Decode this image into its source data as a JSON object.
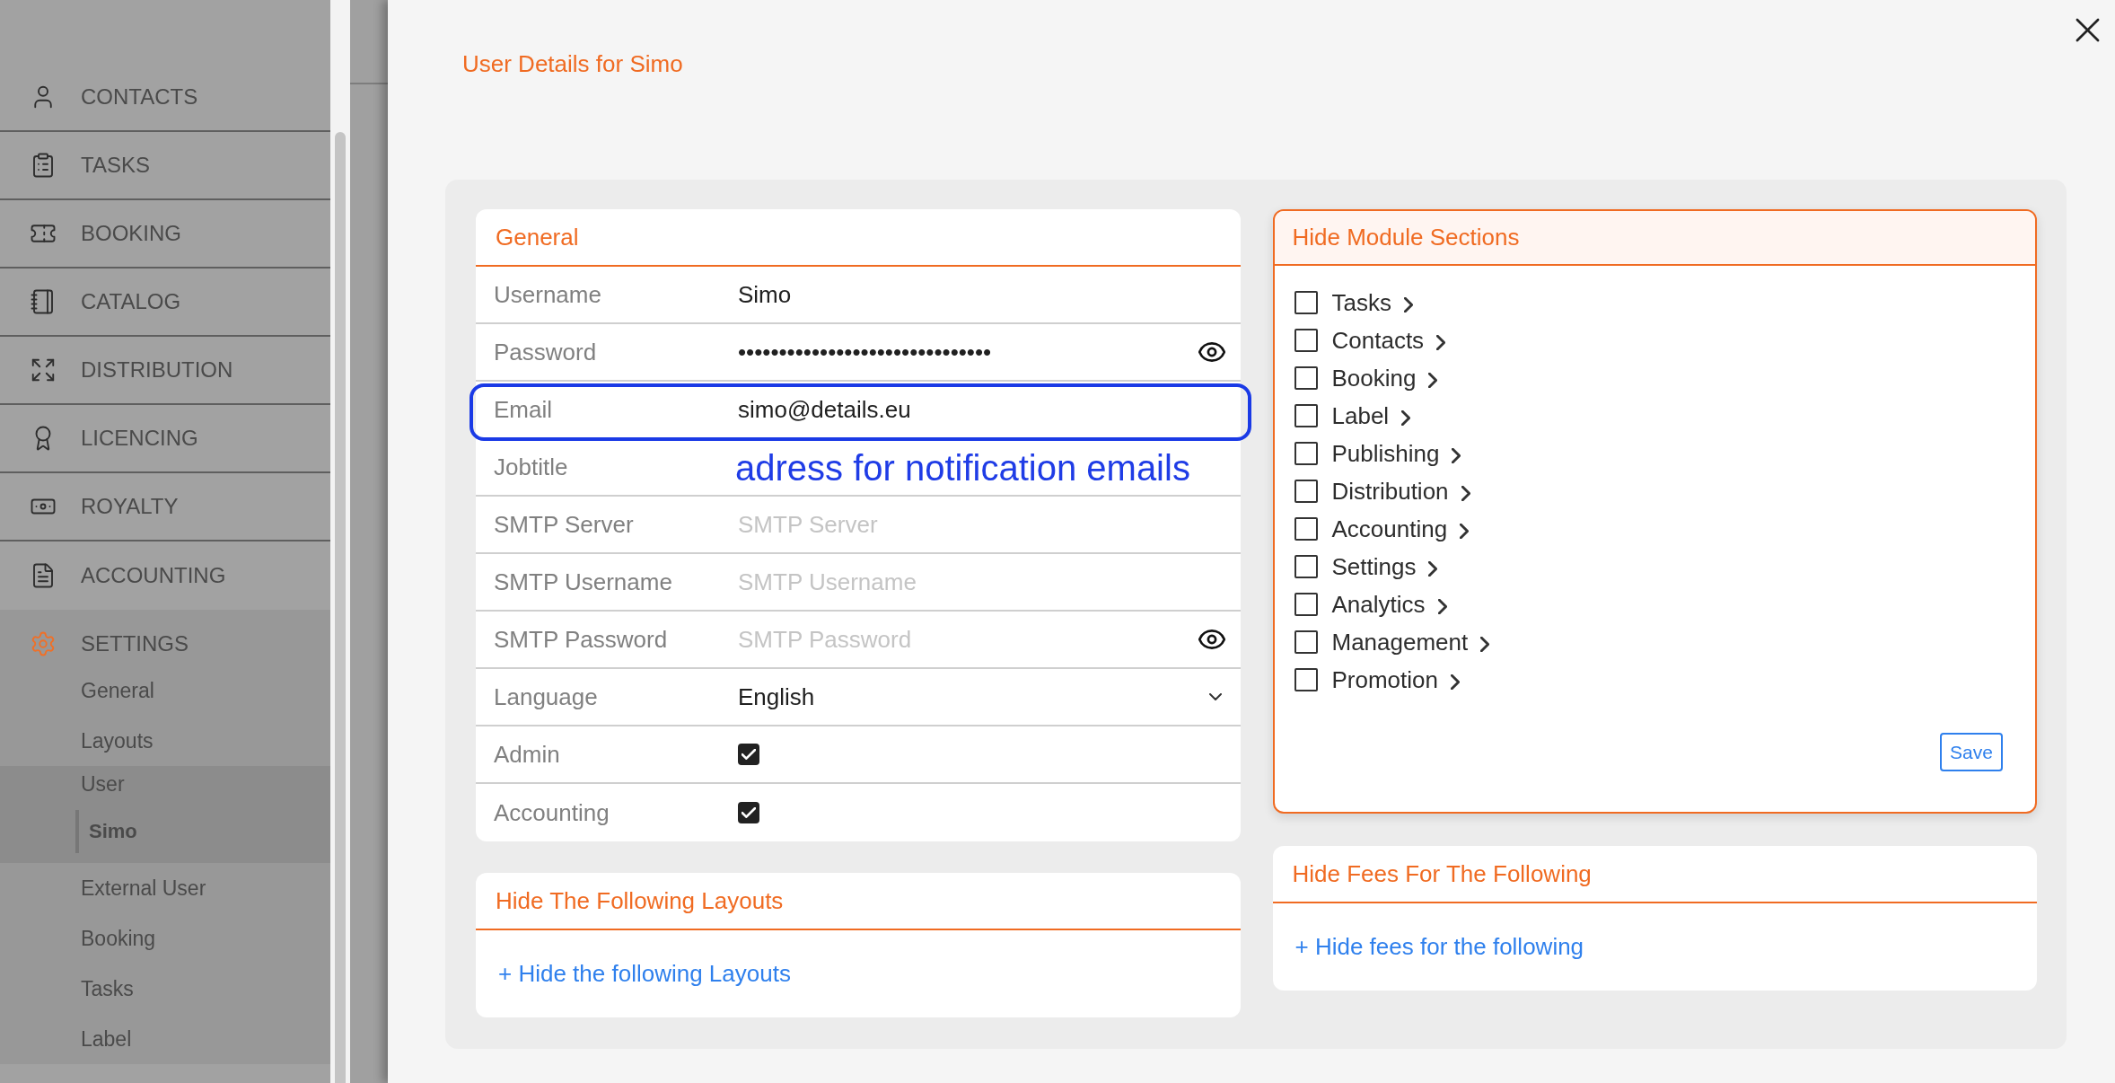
{
  "sidebar": {
    "items": [
      {
        "label": "CONTACTS",
        "expanded": false
      },
      {
        "label": "TASKS",
        "expanded": false
      },
      {
        "label": "BOOKING",
        "expanded": false
      },
      {
        "label": "CATALOG",
        "expanded": false
      },
      {
        "label": "DISTRIBUTION",
        "expanded": false
      },
      {
        "label": "LICENCING",
        "expanded": false
      },
      {
        "label": "ROYALTY",
        "expanded": false
      },
      {
        "label": "ACCOUNTING",
        "expanded": false
      },
      {
        "label": "SETTINGS",
        "expanded": true,
        "children": [
          {
            "label": "General",
            "selected": false,
            "expanded": false
          },
          {
            "label": "Layouts",
            "selected": false,
            "expanded": false
          },
          {
            "label": "User",
            "selected": false,
            "expanded": true,
            "children": [
              {
                "label": "Simo",
                "selected": true
              }
            ]
          },
          {
            "label": "External User",
            "selected": false,
            "expanded": false
          },
          {
            "label": "Booking",
            "selected": false,
            "expanded": false
          },
          {
            "label": "Tasks",
            "selected": false,
            "expanded": false
          },
          {
            "label": "Label",
            "selected": false,
            "expanded": false
          }
        ]
      }
    ]
  },
  "drawer": {
    "title": "User Details for Simo"
  },
  "general": {
    "title": "General",
    "rows": [
      {
        "label": "Username",
        "kind": "text",
        "value": "Simo",
        "highlighted": false
      },
      {
        "label": "Password",
        "kind": "password",
        "value": "•••••••••••••••••••••••••••••••",
        "highlighted": false
      },
      {
        "label": "Email",
        "kind": "text",
        "value": "simo@details.eu",
        "highlighted": true
      },
      {
        "label": "Jobtitle",
        "kind": "text",
        "highlighted": false
      },
      {
        "label": "SMTP Server",
        "kind": "text",
        "placeholder": "SMTP Server",
        "highlighted": false
      },
      {
        "label": "SMTP Username",
        "kind": "text",
        "placeholder": "SMTP Username",
        "highlighted": false
      },
      {
        "label": "SMTP Password",
        "kind": "password",
        "placeholder": "SMTP Password",
        "highlighted": false
      },
      {
        "label": "Language",
        "kind": "select",
        "value": "English",
        "highlighted": false
      },
      {
        "label": "Admin",
        "kind": "checkbox",
        "checked": true,
        "highlighted": false
      },
      {
        "label": "Accounting",
        "kind": "checkbox",
        "checked": true,
        "highlighted": false
      }
    ],
    "annotation": {
      "text": "adress for notification emails"
    }
  },
  "layouts_card": {
    "title": "Hide The Following Layouts",
    "link": "+ Hide the following Layouts"
  },
  "module_sections": {
    "title": "Hide Module Sections",
    "items": [
      {
        "label": "Tasks",
        "checked": false,
        "expanded": false
      },
      {
        "label": "Contacts",
        "checked": false,
        "expanded": false
      },
      {
        "label": "Booking",
        "checked": false,
        "expanded": false
      },
      {
        "label": "Label",
        "checked": false,
        "expanded": false
      },
      {
        "label": "Publishing",
        "checked": false,
        "expanded": false
      },
      {
        "label": "Distribution",
        "checked": false,
        "expanded": false
      },
      {
        "label": "Accounting",
        "checked": false,
        "expanded": false
      },
      {
        "label": "Settings",
        "checked": false,
        "expanded": false
      },
      {
        "label": "Analytics",
        "checked": false,
        "expanded": false
      },
      {
        "label": "Management",
        "checked": false,
        "expanded": false
      },
      {
        "label": "Promotion",
        "checked": false,
        "expanded": false
      }
    ],
    "save_button": "Save"
  },
  "fees_card": {
    "title": "Hide Fees For The Following",
    "link": "+ Hide fees for the following"
  }
}
